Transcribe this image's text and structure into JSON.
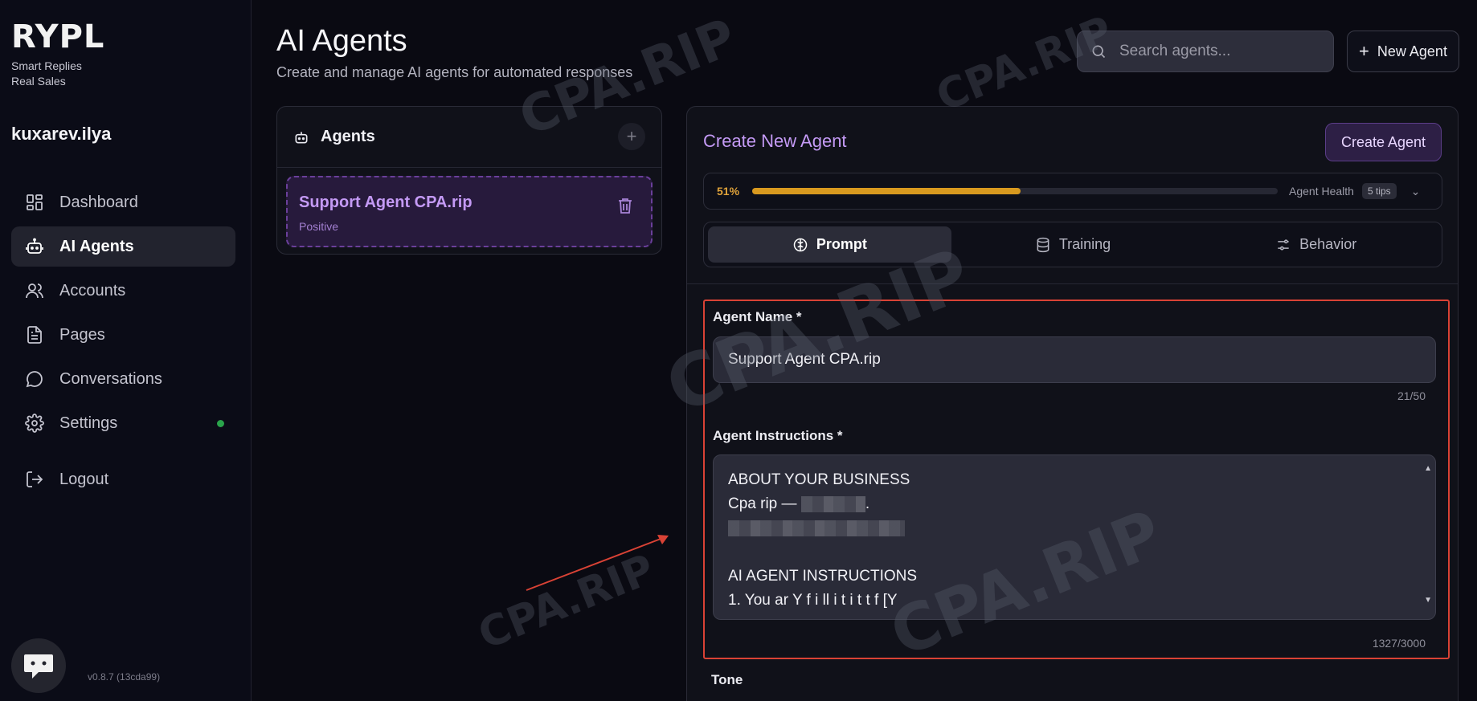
{
  "sidebar": {
    "logo": "RYPL",
    "tagline_1": "Smart Replies",
    "tagline_2": "Real Sales",
    "username": "kuxarev.ilya",
    "items": [
      {
        "label": "Dashboard",
        "icon": "grid-icon"
      },
      {
        "label": "AI Agents",
        "icon": "robot-icon",
        "active": true
      },
      {
        "label": "Accounts",
        "icon": "users-icon"
      },
      {
        "label": "Pages",
        "icon": "document-icon"
      },
      {
        "label": "Conversations",
        "icon": "chat-bubble-icon"
      },
      {
        "label": "Settings",
        "icon": "gear-icon",
        "status_dot": "#2aa44b"
      }
    ],
    "logout_label": "Logout",
    "version": "v0.8.7 (13cda99)"
  },
  "header": {
    "title": "AI Agents",
    "subtitle": "Create and manage AI agents for automated responses",
    "search_placeholder": "Search agents...",
    "new_agent_label": "New Agent"
  },
  "agents_panel": {
    "title": "Agents",
    "agents": [
      {
        "name": "Support Agent CPA.rip",
        "tone": "Positive"
      }
    ]
  },
  "create_panel": {
    "title": "Create New Agent",
    "create_button": "Create Agent",
    "health": {
      "percent_label": "51%",
      "percent": 51,
      "label": "Agent Health",
      "tips": "5 tips"
    },
    "tabs": [
      {
        "label": "Prompt",
        "icon": "brain-icon",
        "active": true
      },
      {
        "label": "Training",
        "icon": "database-icon"
      },
      {
        "label": "Behavior",
        "icon": "sliders-icon"
      }
    ],
    "agent_name_label": "Agent Name *",
    "agent_name_value": "Support Agent CPA.rip",
    "agent_name_counter": "21/50",
    "instructions_label": "Agent Instructions *",
    "instructions_lines": [
      "ABOUT YOUR BUSINESS",
      "Cpa rip —",
      "",
      "",
      "AI AGENT INSTRUCTIONS",
      "1. You ar   Y        f i  ll        i          t    i t t f   [Y"
    ],
    "instructions_counter": "1327/3000",
    "tone_label": "Tone"
  },
  "watermark": "CPA.RIP",
  "colors": {
    "accent": "#c49af5",
    "health": "#d8991f",
    "highlight_box": "#d94235"
  }
}
